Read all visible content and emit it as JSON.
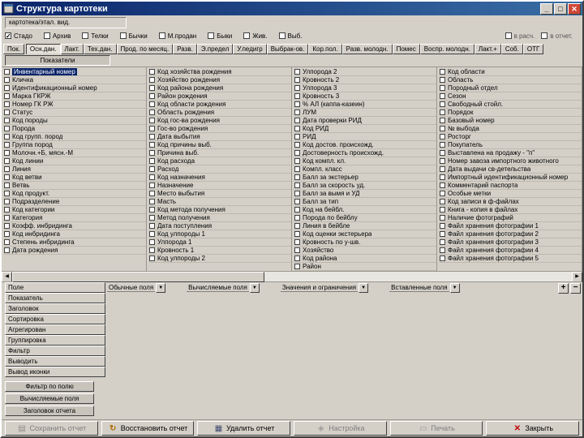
{
  "window": {
    "title": "Структура картотеки",
    "buttons": {
      "minimize": "_",
      "maximize": "□",
      "close": "✕"
    }
  },
  "report_name": "картотека/этал. вид.",
  "filters": {
    "items": [
      {
        "label": "Стадо",
        "checked": true
      },
      {
        "label": "Архив",
        "checked": false
      },
      {
        "label": "Телки",
        "checked": false
      },
      {
        "label": "Бычки",
        "checked": false
      },
      {
        "label": "М.продан",
        "checked": false
      },
      {
        "label": "Быки",
        "checked": false
      },
      {
        "label": "Жив.",
        "checked": false
      },
      {
        "label": "Выб.",
        "checked": false
      }
    ],
    "right_items": [
      {
        "label": "в расч.",
        "checked": false
      },
      {
        "label": "в отчет.",
        "checked": false
      }
    ]
  },
  "tabs": {
    "corner": "Пок.",
    "items": [
      {
        "label": "Осн.дан.",
        "active": true
      },
      {
        "label": "Лакт."
      },
      {
        "label": "Тех.дан."
      },
      {
        "label": "Прод. по месяц."
      },
      {
        "label": "Разв."
      },
      {
        "label": "Э.предел"
      },
      {
        "label": "У.педигр"
      },
      {
        "label": "Выбрак-ов."
      },
      {
        "label": "Кор.пол."
      },
      {
        "label": "Разв. молодн."
      },
      {
        "label": "Помес"
      },
      {
        "label": "Воспр. молодн."
      },
      {
        "label": "Лакт.+"
      },
      {
        "label": "Соб."
      },
      {
        "label": "ОТГ"
      }
    ]
  },
  "indicators_button": "Показатели",
  "fields": {
    "columns": [
      {
        "items": [
          {
            "label": "Инвентарный номер",
            "checked": false,
            "selected": true
          },
          {
            "label": "Кличка",
            "checked": false
          },
          {
            "label": "Идентификационный номер",
            "checked": false
          },
          {
            "label": "Марка ГКРЖ",
            "checked": false
          },
          {
            "label": "Номер ГК РЖ",
            "checked": false
          },
          {
            "label": "Статус",
            "checked": false
          },
          {
            "label": "Код породы",
            "checked": false
          },
          {
            "label": "Порода",
            "checked": false
          },
          {
            "label": "Код групп. пород",
            "checked": false
          },
          {
            "label": "Группа пород",
            "checked": false
          },
          {
            "label": "Молочн.+Б, мясн.-М",
            "checked": false
          },
          {
            "label": "Код линии",
            "checked": false
          },
          {
            "label": "Линия",
            "checked": false
          },
          {
            "label": "Код ветви",
            "checked": false
          },
          {
            "label": "Ветвь",
            "checked": false
          },
          {
            "label": "Код продукт.",
            "checked": false
          },
          {
            "label": "Подразделение",
            "checked": false
          },
          {
            "label": "Код категории",
            "checked": false
          },
          {
            "label": "Категория",
            "checked": false
          },
          {
            "label": "Коэфф. инбридинга",
            "checked": false
          },
          {
            "label": "Код инбридинга",
            "checked": false
          },
          {
            "label": "Степень инбридинга",
            "checked": false
          },
          {
            "label": "Дата рождения",
            "checked": false
          }
        ]
      },
      {
        "items": [
          {
            "label": "Код хозяйства рождения",
            "checked": false
          },
          {
            "label": "Хозяйство рождения",
            "checked": false
          },
          {
            "label": "Код района рождения",
            "checked": false
          },
          {
            "label": "Район рождения",
            "checked": false
          },
          {
            "label": "Код области рождения",
            "checked": false
          },
          {
            "label": "Область рождения",
            "checked": false
          },
          {
            "label": "Код гос-ва рождения",
            "checked": false
          },
          {
            "label": "Гос-во рождения",
            "checked": false
          },
          {
            "label": "Дата выбытия",
            "checked": false
          },
          {
            "label": "Код причины выб.",
            "checked": false
          },
          {
            "label": "Причина выб.",
            "checked": false
          },
          {
            "label": "Код расхода",
            "checked": false
          },
          {
            "label": "Расход",
            "checked": false
          },
          {
            "label": "Код назначения",
            "checked": false
          },
          {
            "label": "Назначение",
            "checked": false
          },
          {
            "label": "Место выбытия",
            "checked": false
          },
          {
            "label": "Масть",
            "checked": false
          },
          {
            "label": "Код метода получения",
            "checked": false
          },
          {
            "label": "Метод получения",
            "checked": false
          },
          {
            "label": "Дата поступления",
            "checked": false
          },
          {
            "label": "Код улпороды 1",
            "checked": false
          },
          {
            "label": "Улпорода 1",
            "checked": false
          },
          {
            "label": "Кровность 1",
            "checked": false
          },
          {
            "label": "Код улпороды 2",
            "checked": false
          }
        ]
      },
      {
        "items": [
          {
            "label": "Улпорода 2",
            "checked": false
          },
          {
            "label": "Кровность 2",
            "checked": false
          },
          {
            "label": "Улпорода 3",
            "checked": false
          },
          {
            "label": "Кровность 3",
            "checked": false
          },
          {
            "label": "% АЛ (каппа-казеин)",
            "checked": false
          },
          {
            "label": "ЛУМ",
            "checked": false
          },
          {
            "label": "Дата проверки РИД",
            "checked": false
          },
          {
            "label": "Код РИД",
            "checked": false
          },
          {
            "label": "РИД",
            "checked": false
          },
          {
            "label": "Код достов. происхожд.",
            "checked": false
          },
          {
            "label": "Достоверность происхожд.",
            "checked": false
          },
          {
            "label": "Код компл. кл.",
            "checked": false
          },
          {
            "label": "Компл. класс",
            "checked": false
          },
          {
            "label": "Балл за экстерьер",
            "checked": false
          },
          {
            "label": "Балл за скорость уд.",
            "checked": false
          },
          {
            "label": "Балл за вымя и УД",
            "checked": false
          },
          {
            "label": "Балл за тип",
            "checked": false
          },
          {
            "label": "Код на бейбл.",
            "checked": false
          },
          {
            "label": "Порода по бейблу",
            "checked": false
          },
          {
            "label": "Линия в бейбле",
            "checked": false
          },
          {
            "label": "Код оценки экстерьера",
            "checked": false
          },
          {
            "label": "Кровность по у-шв.",
            "checked": false
          },
          {
            "label": "Хозяйство",
            "checked": false
          },
          {
            "label": "Код района",
            "checked": false
          },
          {
            "label": "Район",
            "checked": false
          }
        ]
      },
      {
        "items": [
          {
            "label": "Код области",
            "checked": false
          },
          {
            "label": "Область",
            "checked": false
          },
          {
            "label": "Породный отдел",
            "checked": false
          },
          {
            "label": "Сезон",
            "checked": false
          },
          {
            "label": "Свободный стойл.",
            "checked": false
          },
          {
            "label": "Порядок",
            "checked": false
          },
          {
            "label": "Базовый номер",
            "checked": false
          },
          {
            "label": "№ выбода",
            "checked": false
          },
          {
            "label": "Росторг",
            "checked": false
          },
          {
            "label": "Покупатель",
            "checked": false
          },
          {
            "label": "Выставлена на продажу - \"п\"",
            "checked": false
          },
          {
            "label": "Номер завоза импортного животного",
            "checked": false
          },
          {
            "label": "Дата выдачи св-детельства",
            "checked": false
          },
          {
            "label": "Импортный идентификационный номер",
            "checked": false
          },
          {
            "label": "Комментарий паспорта",
            "checked": false
          },
          {
            "label": "Особые метки",
            "checked": false
          },
          {
            "label": "Код записи в ф-файлах",
            "checked": false
          },
          {
            "label": "Книга - копия в файлах",
            "checked": false
          },
          {
            "label": "Наличие фотографий",
            "checked": false
          },
          {
            "label": "Файл хранения фотографии 1",
            "checked": false
          },
          {
            "label": "Файл хранения фотографии 2",
            "checked": false
          },
          {
            "label": "Файл хранения фотографии 3",
            "checked": false
          },
          {
            "label": "Файл хранения фотографии 4",
            "checked": false
          },
          {
            "label": "Файл хранения фотографии 5",
            "checked": false
          }
        ]
      }
    ]
  },
  "scrollbar": {
    "left": "◀",
    "right": "▶"
  },
  "grid": {
    "row_headers": [
      "Поле",
      "Показатель",
      "Заголовок",
      "Сортировка",
      "Агрегирован",
      "Группировка",
      "Фильтр",
      "Выводить",
      "Вывод иконки"
    ],
    "column_headers": [
      {
        "label": "Обычные поля"
      },
      {
        "label": "Вычисляемые поля"
      },
      {
        "label": "Значения и ограничения"
      },
      {
        "label": "Вставленные поля"
      }
    ],
    "dropdown_glyph": "▼",
    "add_label": "+",
    "remove_label": "−"
  },
  "side_buttons": [
    "Фильтр по полю",
    "Вычисляемые поля",
    "Заголовок отчета"
  ],
  "toolbar": {
    "buttons": [
      {
        "label": "Сохранить отчет",
        "icon": "save-icon",
        "disabled": true
      },
      {
        "label": "Восстановить отчет",
        "icon": "restore-icon",
        "disabled": false
      },
      {
        "label": "Удалить отчет",
        "icon": "delete-icon",
        "disabled": false
      },
      {
        "label": "Настройка",
        "icon": "settings-icon",
        "disabled": true
      },
      {
        "label": "Печать",
        "icon": "print-icon",
        "disabled": true
      },
      {
        "label": "Закрыть",
        "icon": "close-icon",
        "disabled": false
      }
    ]
  }
}
